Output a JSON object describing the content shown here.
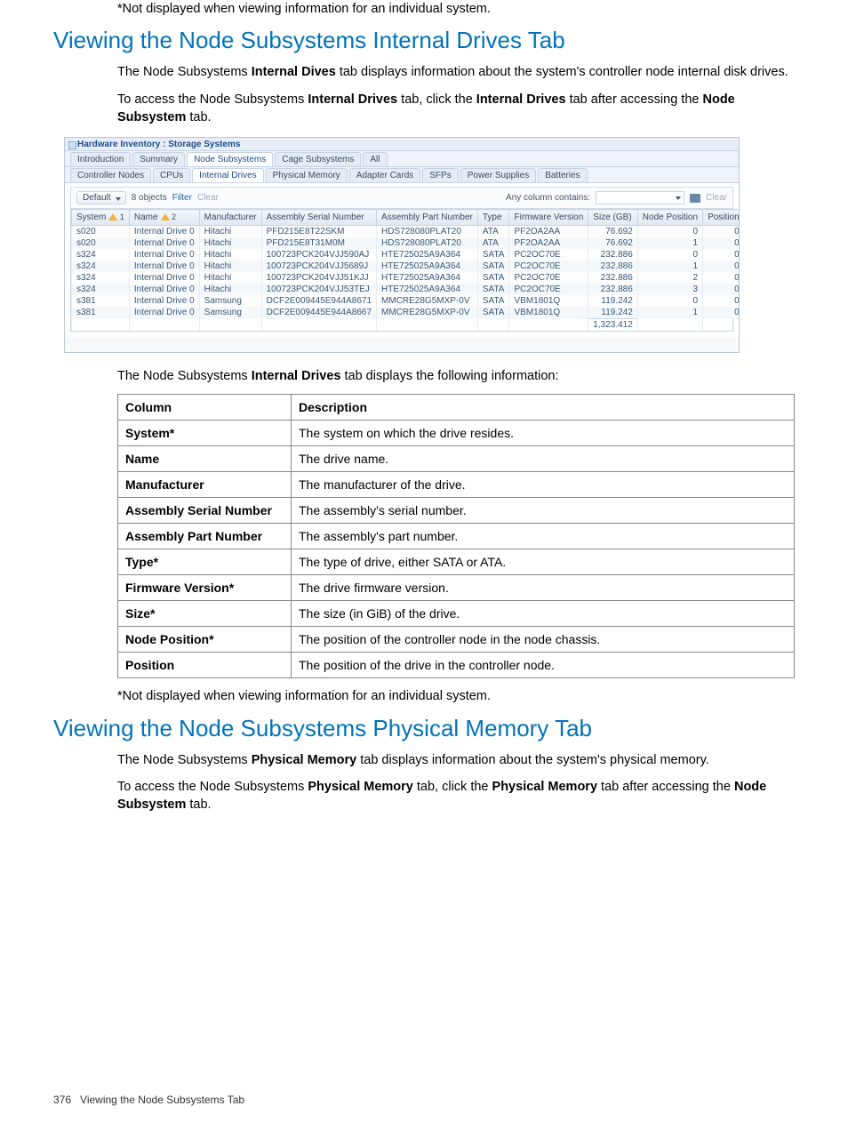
{
  "notes": {
    "asterisk": "*Not displayed when viewing information for an individual system."
  },
  "sections": {
    "drives": {
      "heading": "Viewing the Node Subsystems Internal Drives Tab",
      "p1a": "The Node Subsystems ",
      "p1b": "Internal Dives",
      "p1c": " tab displays information about the system's controller node internal disk drives.",
      "p2a": "To access the Node Subsystems ",
      "p2b": "Internal Drives",
      "p2c": " tab, click the ",
      "p2d": "Internal Drives",
      "p2e": " tab after accessing the ",
      "p2f": "Node Subsystem",
      "p2g": " tab.",
      "after_ss_a": "The Node Subsystems ",
      "after_ss_b": "Internal Drives",
      "after_ss_c": " tab displays the following information:"
    },
    "memory": {
      "heading": "Viewing the Node Subsystems Physical Memory Tab",
      "p1a": "The Node Subsystems ",
      "p1b": "Physical Memory",
      "p1c": " tab displays information about the system's physical memory.",
      "p2a": "To access the Node Subsystems ",
      "p2b": "Physical Memory",
      "p2c": " tab, click the ",
      "p2d": "Physical Memory",
      "p2e": " tab after accessing the ",
      "p2f": "Node Subsystem",
      "p2g": " tab."
    }
  },
  "screenshot": {
    "title": "Hardware Inventory : Storage Systems",
    "tabs1": [
      "Introduction",
      "Summary",
      "Node Subsystems",
      "Cage Subsystems",
      "All"
    ],
    "tabs1_active": 2,
    "tabs2": [
      "Controller Nodes",
      "CPUs",
      "Internal Drives",
      "Physical Memory",
      "Adapter Cards",
      "SFPs",
      "Power Supplies",
      "Batteries"
    ],
    "tabs2_active": 2,
    "toolbar": {
      "default_btn": "Default",
      "objects": "8 objects",
      "filter": "Filter",
      "clear": "Clear",
      "any_col": "Any column contains:",
      "clear2": "Clear"
    },
    "columns": [
      "System",
      "Name",
      "Manufacturer",
      "Assembly Serial Number",
      "Assembly Part Number",
      "Type",
      "Firmware Version",
      "Size (GB)",
      "Node Position",
      "Position"
    ],
    "header_warn_col0": "1",
    "header_warn_col1": "2",
    "rows": [
      [
        "s020",
        "Internal Drive 0",
        "Hitachi",
        "PFD215E8T22SKM",
        "HDS728080PLAT20",
        "ATA",
        "PF2OA2AA",
        "76.692",
        "0",
        "0"
      ],
      [
        "s020",
        "Internal Drive 0",
        "Hitachi",
        "PFD215E8T31M0M",
        "HDS728080PLAT20",
        "ATA",
        "PF2OA2AA",
        "76.692",
        "1",
        "0"
      ],
      [
        "s324",
        "Internal Drive 0",
        "Hitachi",
        "100723PCK204VJJ590AJ",
        "HTE725025A9A364",
        "SATA",
        "PC2OC70E",
        "232.886",
        "0",
        "0"
      ],
      [
        "s324",
        "Internal Drive 0",
        "Hitachi",
        "100723PCK204VJJ5689J",
        "HTE725025A9A364",
        "SATA",
        "PC2OC70E",
        "232.886",
        "1",
        "0"
      ],
      [
        "s324",
        "Internal Drive 0",
        "Hitachi",
        "100723PCK204VJJ51KJJ",
        "HTE725025A9A364",
        "SATA",
        "PC2OC70E",
        "232.886",
        "2",
        "0"
      ],
      [
        "s324",
        "Internal Drive 0",
        "Hitachi",
        "100723PCK204VJJ53TEJ",
        "HTE725025A9A364",
        "SATA",
        "PC2OC70E",
        "232.886",
        "3",
        "0"
      ],
      [
        "s381",
        "Internal Drive 0",
        "Samsung",
        "DCF2E009445E944A8671",
        "MMCRE28G5MXP-0V",
        "SATA",
        "VBM1801Q",
        "119.242",
        "0",
        "0"
      ],
      [
        "s381",
        "Internal Drive 0",
        "Samsung",
        "DCF2E009445E944A8667",
        "MMCRE28G5MXP-0V",
        "SATA",
        "VBM1801Q",
        "119.242",
        "1",
        "0"
      ]
    ],
    "total": "1,323.412"
  },
  "doc_table": {
    "headers": [
      "Column",
      "Description"
    ],
    "rows": [
      [
        "System*",
        "The system on which the drive resides."
      ],
      [
        "Name",
        "The drive name."
      ],
      [
        "Manufacturer",
        "The manufacturer of the drive."
      ],
      [
        "Assembly Serial Number",
        "The assembly's serial number."
      ],
      [
        "Assembly Part Number",
        "The assembly's part number."
      ],
      [
        "Type*",
        "The type of drive, either SATA or ATA."
      ],
      [
        "Firmware Version*",
        "The drive firmware version."
      ],
      [
        "Size*",
        "The size (in GiB) of the drive."
      ],
      [
        "Node Position*",
        "The position of the controller node in the node chassis."
      ],
      [
        "Position",
        "The position of the drive in the controller node."
      ]
    ]
  },
  "footer": {
    "page": "376",
    "label": "Viewing the Node Subsystems Tab"
  }
}
